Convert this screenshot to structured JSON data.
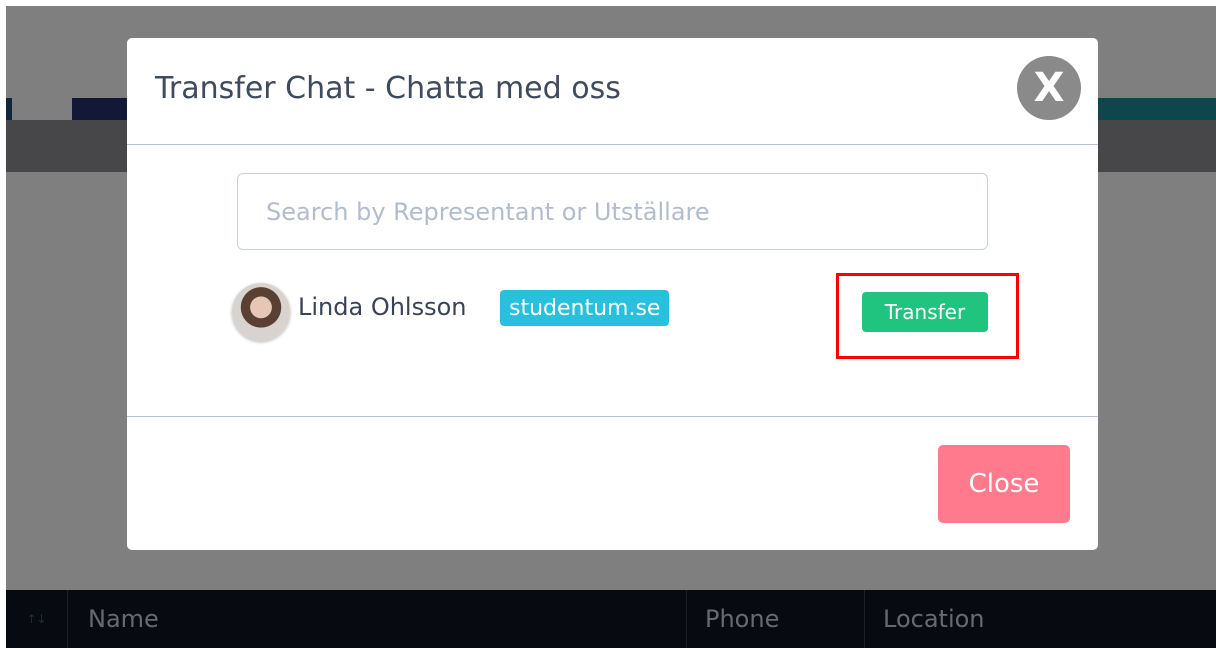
{
  "modal": {
    "title": "Transfer Chat - Chatta med oss",
    "close_icon_glyph": "X",
    "search": {
      "placeholder": "Search by Representant or Utställare",
      "value": ""
    },
    "representatives": [
      {
        "name": "Linda Ohlsson",
        "company": "studentum.se",
        "action_label": "Transfer"
      }
    ],
    "close_label": "Close"
  },
  "table": {
    "sort_icon": "↑↓",
    "columns": [
      "Name",
      "Phone",
      "Location"
    ]
  },
  "colors": {
    "transfer_button": "#21c47f",
    "close_button": "#ff7a8c",
    "company_badge": "#29c0dd",
    "highlight": "#ff0000"
  }
}
